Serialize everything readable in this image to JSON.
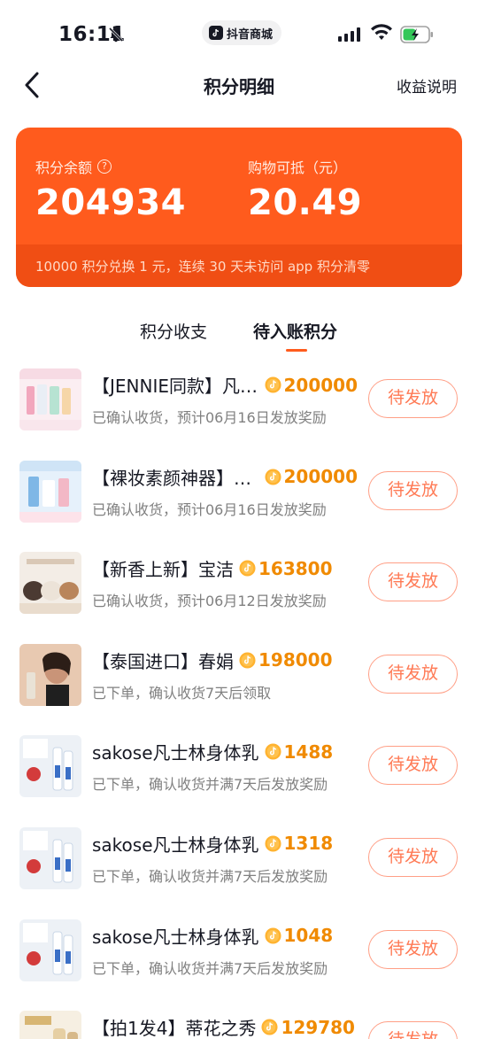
{
  "status_bar": {
    "time": "16:11",
    "app_name": "抖音商城"
  },
  "nav": {
    "title": "积分明细",
    "right_link": "收益说明"
  },
  "card": {
    "balance_label": "积分余额",
    "balance_value": "204934",
    "deduct_label": "购物可抵（元）",
    "deduct_value": "20.49",
    "footer_note": "10000 积分兑换 1 元，连续 30 天未访问 app 积分清零"
  },
  "tabs": [
    {
      "label": "积分收支",
      "active": false
    },
    {
      "label": "待入账积分",
      "active": true
    }
  ],
  "items": [
    {
      "title": "【JENNIE同款】凡士林身体乳",
      "points": "200000",
      "desc": "已确认收货，预计06月16日发放奖励",
      "button": "待发放",
      "thumb": "vaseline-pink"
    },
    {
      "title": "【裸妆素颜神器】凡士林",
      "points": "200000",
      "desc": "已确认收货，预计06月16日发放奖励",
      "button": "待发放",
      "thumb": "vaseline-blue"
    },
    {
      "title": "【新香上新】宝洁",
      "points": "163800",
      "desc": "已确认收货，预计06月12日发放奖励",
      "button": "待发放",
      "thumb": "jars"
    },
    {
      "title": "【泰国进口】春娟",
      "points": "198000",
      "desc": "已下单，确认收货7天后领取",
      "button": "待发放",
      "thumb": "portrait"
    },
    {
      "title": "sakose凡士林身体乳",
      "points": "1488",
      "desc": "已下单，确认收货并满7天后发放奖励",
      "button": "待发放",
      "thumb": "sakose"
    },
    {
      "title": "sakose凡士林身体乳",
      "points": "1318",
      "desc": "已下单，确认收货并满7天后发放奖励",
      "button": "待发放",
      "thumb": "sakose"
    },
    {
      "title": "sakose凡士林身体乳",
      "points": "1048",
      "desc": "已下单，确认收货并满7天后发放奖励",
      "button": "待发放",
      "thumb": "sakose"
    },
    {
      "title": "【拍1发4】蒂花之秀",
      "points": "129780",
      "desc": "",
      "button": "待发放",
      "thumb": "shampoo"
    }
  ],
  "colors": {
    "accent": "#ff5b1d",
    "points": "#f08a00",
    "button_text": "#ff7a55"
  }
}
